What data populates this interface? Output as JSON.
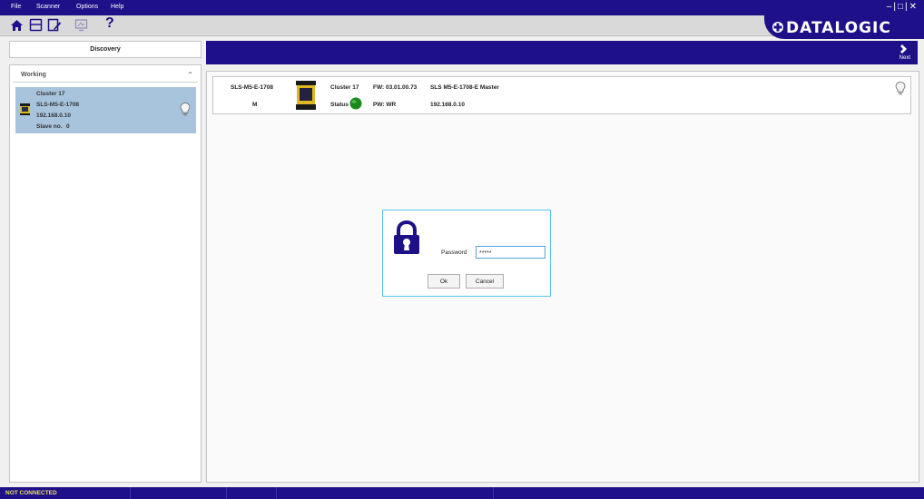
{
  "menu": [
    "File",
    "Scanner",
    "Options",
    "Help"
  ],
  "window_controls": "–|□|✕",
  "toolbar": {
    "icons": [
      "home-icon",
      "save-icon",
      "edit-document-icon",
      "monitor-icon",
      "help-icon"
    ],
    "help_label": "?"
  },
  "brand": {
    "logo": "DATALOGIC",
    "color": "#1e1088"
  },
  "discovery": {
    "label": "Discovery"
  },
  "nav": {
    "next_label": "Next"
  },
  "sidebar": {
    "section_title": "Working",
    "device": {
      "cluster": "Cluster 17",
      "model": "SLS-M5-E-1708",
      "ip": "192.168.0.10",
      "slave_label": "Slave no.",
      "slave_value": "0"
    }
  },
  "device_info": {
    "model": "SLS-M5-E-1708",
    "role": "M",
    "cluster": "Cluster 17",
    "status_label": "Status",
    "fw": "FW: 03.01.00.73",
    "pw": "PW: WR",
    "description": "SLS M5-E-1708-E Master",
    "ip": "192.168.0.10",
    "status_color": "#1a8a1a"
  },
  "dialog": {
    "password_label": "Password",
    "password_value": "*****",
    "ok_label": "Ok",
    "cancel_label": "Cancel"
  },
  "status_bar": {
    "text": "NOT CONNECTED"
  }
}
